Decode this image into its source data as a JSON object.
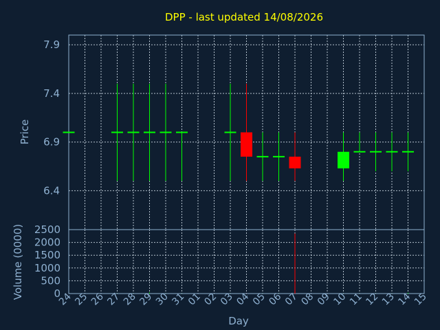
{
  "chart_data": {
    "type": "candlestick",
    "title": "DPP - last updated 14/08/2026",
    "xlabel": "Day",
    "price_panel": {
      "ylabel": "Price",
      "ylim": [
        6.0,
        8.0
      ],
      "yticks": [
        "6.4",
        "6.9",
        "7.4",
        "7.9"
      ],
      "grid": true
    },
    "volume_panel": {
      "ylabel": "Volume (0000)",
      "ylim": [
        0,
        2500
      ],
      "yticks": [
        "0",
        "500",
        "1000",
        "1500",
        "2000",
        "2500"
      ],
      "grid": true
    },
    "x_ticks": [
      "24",
      "25",
      "26",
      "27",
      "28",
      "29",
      "30",
      "31",
      "01",
      "02",
      "03",
      "04",
      "05",
      "06",
      "07",
      "08",
      "09",
      "10",
      "11",
      "12",
      "13",
      "14",
      "15"
    ],
    "colors": {
      "up": "#00ff00",
      "down": "#ff0000",
      "title": "#ffff00",
      "axis": "#8fb1d1",
      "background": "#0f1e30"
    },
    "candles": [
      {
        "day": "24",
        "open": 7.0,
        "high": 7.0,
        "low": 7.0,
        "close": 7.0,
        "volume": 0
      },
      {
        "day": "27",
        "open": 7.0,
        "high": 7.5,
        "low": 6.5,
        "close": 7.0,
        "volume": 5
      },
      {
        "day": "28",
        "open": 7.0,
        "high": 7.5,
        "low": 6.5,
        "close": 7.0,
        "volume": 5
      },
      {
        "day": "29",
        "open": 7.0,
        "high": 7.5,
        "low": 6.5,
        "close": 7.0,
        "volume": 40
      },
      {
        "day": "30",
        "open": 7.0,
        "high": 7.5,
        "low": 6.5,
        "close": 7.0,
        "volume": 5
      },
      {
        "day": "31",
        "open": 7.0,
        "high": 7.0,
        "low": 6.5,
        "close": 7.0,
        "volume": 5
      },
      {
        "day": "03",
        "open": 7.0,
        "high": 7.5,
        "low": 6.5,
        "close": 7.0,
        "volume": 5
      },
      {
        "day": "04",
        "open": 7.0,
        "high": 7.5,
        "low": 6.5,
        "close": 6.75,
        "volume": 5
      },
      {
        "day": "05",
        "open": 6.75,
        "high": 7.0,
        "low": 6.5,
        "close": 6.75,
        "volume": 5
      },
      {
        "day": "06",
        "open": 6.75,
        "high": 7.0,
        "low": 6.5,
        "close": 6.75,
        "volume": 5
      },
      {
        "day": "07",
        "open": 6.75,
        "high": 7.0,
        "low": 6.5,
        "close": 6.63,
        "volume": 2350
      },
      {
        "day": "10",
        "open": 6.63,
        "high": 7.0,
        "low": 6.5,
        "close": 6.8,
        "volume": 5
      },
      {
        "day": "11",
        "open": 6.8,
        "high": 7.0,
        "low": 6.8,
        "close": 6.8,
        "volume": 5
      },
      {
        "day": "12",
        "open": 6.8,
        "high": 7.0,
        "low": 6.6,
        "close": 6.8,
        "volume": 5
      },
      {
        "day": "13",
        "open": 6.8,
        "high": 7.0,
        "low": 6.6,
        "close": 6.8,
        "volume": 5
      },
      {
        "day": "14",
        "open": 6.8,
        "high": 7.0,
        "low": 6.6,
        "close": 6.8,
        "volume": 30
      }
    ]
  }
}
